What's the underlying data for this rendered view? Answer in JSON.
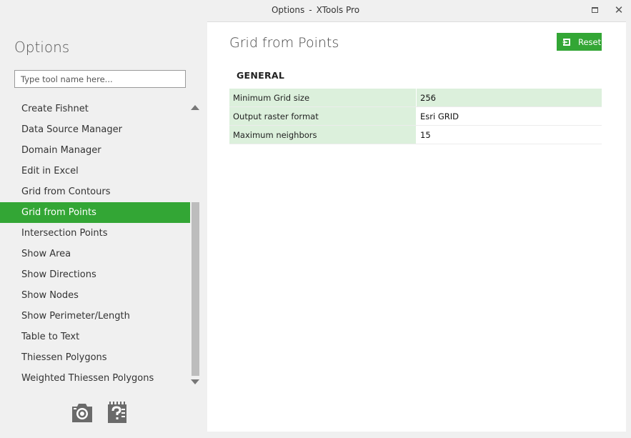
{
  "window": {
    "title_left": "Options",
    "title_sep": "-",
    "title_right": "XTools Pro"
  },
  "sidebar": {
    "heading": "Options",
    "search_placeholder": "Type tool name here...",
    "selected": "Grid from Points",
    "items": [
      {
        "label": "Create Fishnet"
      },
      {
        "label": "Data Source Manager"
      },
      {
        "label": "Domain Manager"
      },
      {
        "label": "Edit in Excel"
      },
      {
        "label": "Grid from Contours"
      },
      {
        "label": "Grid from Points"
      },
      {
        "label": "Intersection Points"
      },
      {
        "label": "Show Area"
      },
      {
        "label": "Show Directions"
      },
      {
        "label": "Show Nodes"
      },
      {
        "label": "Show Perimeter/Length"
      },
      {
        "label": "Table to Text"
      },
      {
        "label": "Thiessen Polygons"
      },
      {
        "label": "Weighted Thiessen Polygons"
      }
    ],
    "bottom_icons": [
      "camera-icon",
      "help-icon"
    ]
  },
  "content": {
    "title": "Grid from Points",
    "reset_label": "Reset",
    "section": "GENERAL",
    "properties": [
      {
        "name": "Minimum Grid size",
        "value": "256"
      },
      {
        "name": "Output raster format",
        "value": "Esri GRID"
      },
      {
        "name": "Maximum neighbors",
        "value": "15"
      }
    ]
  },
  "colors": {
    "accent": "#33a635",
    "property_bg": "#dcf0dc"
  }
}
